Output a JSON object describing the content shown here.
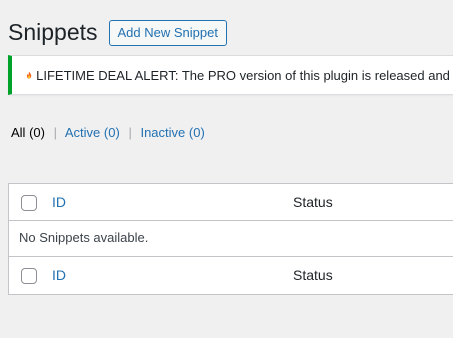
{
  "header": {
    "title": "Snippets",
    "add_new_label": "Add New Snippet"
  },
  "notice": {
    "icon": "fire-icon",
    "text": "LIFETIME DEAL ALERT: The PRO version of this plugin is released and an",
    "accent_color": "#00a32a"
  },
  "filters": {
    "all": {
      "label": "All",
      "count": "(0)"
    },
    "active": {
      "label": "Active",
      "count": "(0)"
    },
    "inactive": {
      "label": "Inactive",
      "count": "(0)"
    },
    "separator": "|"
  },
  "table": {
    "columns": {
      "id": "ID",
      "status": "Status"
    },
    "empty_message": "No Snippets available."
  },
  "colors": {
    "link": "#2271b1",
    "background": "#f0f0f1"
  }
}
